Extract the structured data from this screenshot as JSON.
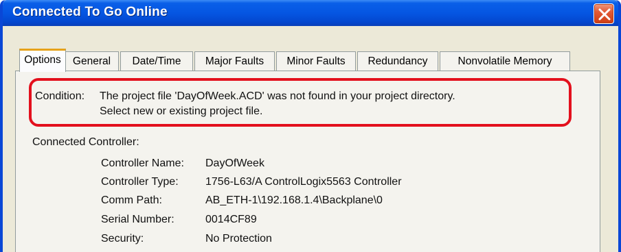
{
  "window": {
    "title": "Connected To Go Online"
  },
  "tabs": [
    {
      "label": "Options",
      "active": true
    },
    {
      "label": "General",
      "active": false
    },
    {
      "label": "Date/Time",
      "active": false
    },
    {
      "label": "Major Faults",
      "active": false
    },
    {
      "label": "Minor Faults",
      "active": false
    },
    {
      "label": "Redundancy",
      "active": false
    },
    {
      "label": "Nonvolatile Memory",
      "active": false
    }
  ],
  "condition": {
    "label": "Condition:",
    "line1": "The project file 'DayOfWeek.ACD' was not found in your project directory.",
    "line2": "Select new or existing project file."
  },
  "controller": {
    "heading": "Connected Controller:",
    "fields": [
      {
        "label": "Controller Name:",
        "value": "DayOfWeek"
      },
      {
        "label": "Controller Type:",
        "value": "1756-L63/A ControlLogix5563 Controller"
      },
      {
        "label": "Comm Path:",
        "value": "AB_ETH-1\\192.168.1.4\\Backplane\\0"
      },
      {
        "label": "Serial Number:",
        "value": "0014CF89"
      },
      {
        "label": "Security:",
        "value": "No Protection"
      }
    ]
  },
  "colors": {
    "title_bar": "#0556e2",
    "highlight_outline": "#e3101d",
    "active_tab_accent": "#e6a21a",
    "close_button": "#e25a36"
  },
  "icons": {
    "close": "close-icon"
  }
}
